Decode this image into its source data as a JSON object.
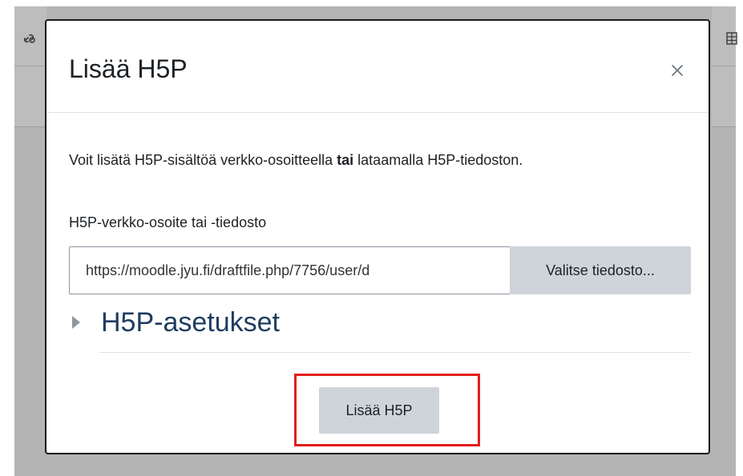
{
  "modal": {
    "title": "Lisää H5P",
    "close_glyph": "×",
    "close_icon": "close-icon"
  },
  "content": {
    "intro_before": "Voit lisätä H5P-sisältöä verkko-osoitteella ",
    "intro_bold": "tai",
    "intro_after": " lataamalla H5P-tiedoston.",
    "field_label": "H5P-verkko-osoite tai -tiedosto",
    "url_value": "https://moodle.jyu.fi/draftfile.php/7756/user/d",
    "choose_file_label": "Valitse tiedosto...",
    "section_title": "H5P-asetukset",
    "section_icon": "caret-right-icon"
  },
  "footer": {
    "submit_label": "Lisää H5P"
  },
  "background_icons": [
    "link-icon",
    "table-icon"
  ],
  "colors": {
    "highlight": "#e41d1d",
    "section_title": "#1f3c60",
    "button_bg": "#ced4da"
  }
}
